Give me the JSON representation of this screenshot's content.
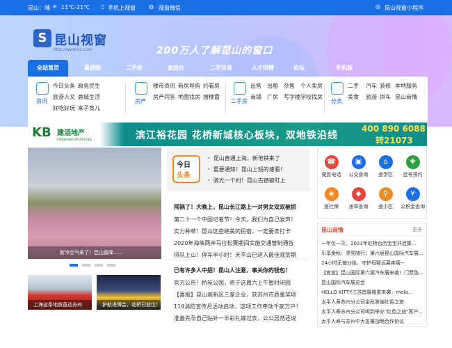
{
  "topbar": {
    "weather": "昆山：晴",
    "temp": "11℃-21℃",
    "mobile": "手机上视窗",
    "wechat": "视窗微信",
    "miniprogram": "昆山视窗小程序"
  },
  "header": {
    "logo_name": "昆山视窗",
    "logo_url": "Http://www.ks.com",
    "slogan": "200万人了解昆山的窗口"
  },
  "nav": {
    "items": [
      "全站首页",
      "看房团",
      "二手房",
      "查房价",
      "二手交易",
      "人才招聘",
      "论坛",
      "手机版"
    ]
  },
  "subnav": {
    "groups": [
      {
        "label": "资讯",
        "links": [
          "今日头条",
          "政务民生",
          "旅游人文",
          "鹿城生活",
          "好吃好玩",
          "来子育儿"
        ]
      },
      {
        "label": "房产",
        "links": [
          "楼市资讯",
          "新房导购",
          "约看房",
          "房产问答",
          "地图找房",
          "搜楼盘"
        ]
      },
      {
        "label": "二手房",
        "links": [
          "出售",
          "出租",
          "杂售",
          "个人卖房",
          "商铺",
          "厂房",
          "写字楼",
          "学校找房"
        ]
      },
      {
        "label": "分类",
        "links": [
          "二手",
          "汽车",
          "装修",
          "本地服务",
          "美食",
          "旅游",
          "拼车",
          "昆山商情"
        ]
      }
    ]
  },
  "banner": {
    "logo": "KB",
    "company": "建滔地产",
    "company_en": "KINGBOARD PROPERTIES",
    "headline": "滨江裕花园  花桥新城核心板块，双地铁沿线",
    "phone": "400 890 6088",
    "ext": "转21073"
  },
  "slider": {
    "caption": "新冷空气来了！昆山直降......"
  },
  "thumbs": [
    {
      "caption": "上海这条地铁直达苏州"
    },
    {
      "caption": "护航进博会，花桥已就位！"
    }
  ],
  "toutiao": {
    "badge_top": "今日",
    "badge_bottom": "头条",
    "lines": [
      "昆山直通上海，新地铁来了",
      "重要通知！昆山上班的速看！",
      "骑光一个村！昆山古镇被盯上"
    ]
  },
  "news": {
    "block1_title": "闯祸了！大晚上，昆山长江路上一对男女双双被抓",
    "block1_lines": [
      "第二十一个中国记者节！今天，我们为自己发声！",
      "实力种草！昆山这些绝美的民宿，一定要去打卡",
      "2020年海峡两岸马拉松赛期间实施交通管制通告",
      "排队上山！停车半小时！天平山已进入最佳观赏期"
    ],
    "block2_title": "已有许多人中招！昆山人注意，事关你的钱包！",
    "block2_lines": [
      "官方公告！桥苑公园，将于这周六上午暂时闭园",
      "【喜报】昆山高新区三家企业，获苏州市质量奖项",
      "119消防宣传月活动启动，这项工作牵动千家万户！",
      "准备先孕自己贴补一半彩礼嫁过去，公公居然还说"
    ]
  },
  "services": [
    {
      "label": "便民电话",
      "icon": "phone-icon",
      "color": "#e7463a"
    },
    {
      "label": "公交查询",
      "icon": "bus-icon",
      "color": "#1b6fe5"
    },
    {
      "label": "查学区",
      "icon": "school-icon",
      "color": "#1b6fe5"
    },
    {
      "label": "挂号预约",
      "icon": "hospital-icon",
      "color": "#2ea043"
    },
    {
      "label": "查社保",
      "icon": "social-security-icon",
      "color": "#f18a22"
    },
    {
      "label": "违章查询",
      "icon": "car-icon",
      "color": "#e7463a"
    },
    {
      "label": "查小区",
      "icon": "community-icon",
      "color": "#f18a22"
    },
    {
      "label": "公积金查询",
      "icon": "fund-icon",
      "color": "#1b6fe5"
    }
  ],
  "biz": {
    "title": "昆山商情",
    "more": "更多",
    "lines": [
      "一年仅一次，2021年虹桥台历宝宝开启集...",
      "乐享金秋，漂亮随行；第六届昆山国际汽车展...",
      "24小时无偏分娩，守护母婴远离疼痛~",
      "【官宣】昆山国际第六届汽车展来袭！门票免...",
      "昆山国际汽车展览会",
      "HELLO KITTY江苏首展隆重来袭，mela...",
      "太平人寿苏州分公司金秋答谢红色之旅",
      "太平人寿苏州分公司喝到举办\"红色之旅\"客户...",
      "太平人寿与苏州中大签署战略合作协议"
    ]
  }
}
